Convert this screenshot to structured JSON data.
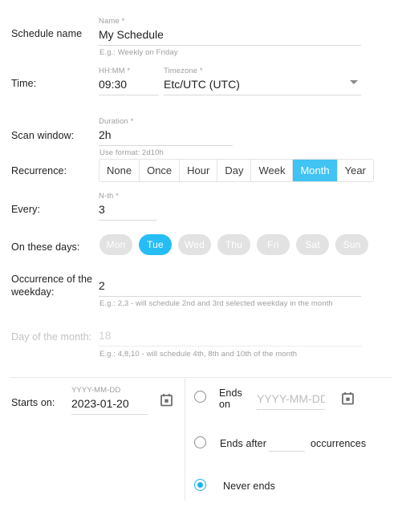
{
  "form": {
    "schedule_name": {
      "label": "Schedule name",
      "field_label": "Name *",
      "value": "My Schedule",
      "hint": "E.g.: Weekly on Friday"
    },
    "time": {
      "label": "Time:",
      "hhmm_label": "HH:MM *",
      "hhmm_value": "09:30",
      "timezone_label": "Timezone *",
      "timezone_value": "Etc/UTC (UTC)"
    },
    "scan_window": {
      "label": "Scan window:",
      "field_label": "Duration *",
      "value": "2h",
      "hint": "Use format: 2d10h"
    },
    "recurrence": {
      "label": "Recurrence:",
      "options": [
        "None",
        "Once",
        "Hour",
        "Day",
        "Week",
        "Month",
        "Year"
      ],
      "selected": "Month"
    },
    "every": {
      "label": "Every:",
      "field_label": "N-th *",
      "value": "3"
    },
    "on_these_days": {
      "label": "On these days:",
      "days": [
        "Mon",
        "Tue",
        "Wed",
        "Thu",
        "Fri",
        "Sat",
        "Sun"
      ],
      "selected": [
        "Tue"
      ]
    },
    "occurrence_of_weekday": {
      "label": "Occurrence of the weekday:",
      "value": "2",
      "hint": "E.g.: 2,3 - will schedule 2nd and 3rd selected weekday in the month"
    },
    "day_of_month": {
      "label": "Day of the month:",
      "value": "18",
      "hint": "E.g.: 4,8,10 - will schedule 4th, 8th and 10th of the month",
      "disabled": "true"
    },
    "starts_on": {
      "label": "Starts on:",
      "field_label": "YYYY-MM-DD",
      "value": "2023-01-20"
    },
    "ends": {
      "ends_on_label_line1": "Ends",
      "ends_on_label_line2": "on",
      "ends_on_placeholder": "YYYY-MM-DD",
      "ends_on_value": "",
      "ends_after_label": "Ends after",
      "ends_after_value": "",
      "occurrences_label": "occurrences",
      "never_ends_label": "Never ends",
      "selected": "never_ends"
    }
  },
  "colors": {
    "accent": "#41c3f4",
    "accent_chip": "#26bdf5",
    "radio_checked": "#19b3ef",
    "chip_idle": "#e2e2e2",
    "text": "#212121",
    "muted": "#9e9e9e",
    "divider": "#e6e6e6"
  }
}
